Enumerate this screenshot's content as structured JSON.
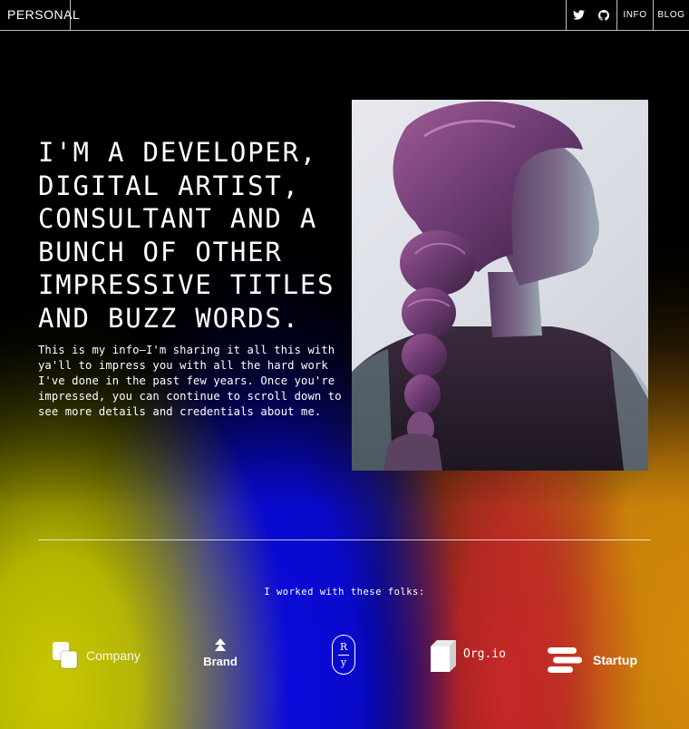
{
  "header": {
    "brand": "PERSONAL",
    "nav": [
      {
        "id": "twitter",
        "icon": "twitter-icon"
      },
      {
        "id": "github",
        "icon": "github-icon"
      },
      {
        "id": "info",
        "label": "INFO"
      },
      {
        "id": "blog",
        "label": "BLOG"
      }
    ]
  },
  "hero": {
    "title": "I'M A DEVELOPER,\nDIGITAL ARTIST,\nCONSULTANT AND A\nBUNCH OF OTHER\nIMPRESSIVE TITLES\nAND BUZZ WORDS.",
    "body": "This is my info—I'm sharing it all this with ya'll to impress you with all the hard work I've done in the past few years. Once you're impressed, you can continue to scroll down to see more details and credentials about me.",
    "portrait_icon": "portrait-photo"
  },
  "clients": {
    "heading": "I worked with these folks:",
    "logos": [
      {
        "name": "Company",
        "icon": "company-logo-icon"
      },
      {
        "name": "Brand",
        "icon": "brand-logo-icon"
      },
      {
        "name": "R y",
        "icon": "ry-logo-icon",
        "top": "R",
        "bottom": "y"
      },
      {
        "name": "Org.io",
        "icon": "org-logo-icon"
      },
      {
        "name": "Startup",
        "icon": "startup-logo-icon"
      }
    ]
  },
  "colors": {
    "yellow": "#c8c800",
    "blue": "#0a0ae0",
    "red": "#c82828",
    "orange": "#d68a0a"
  }
}
